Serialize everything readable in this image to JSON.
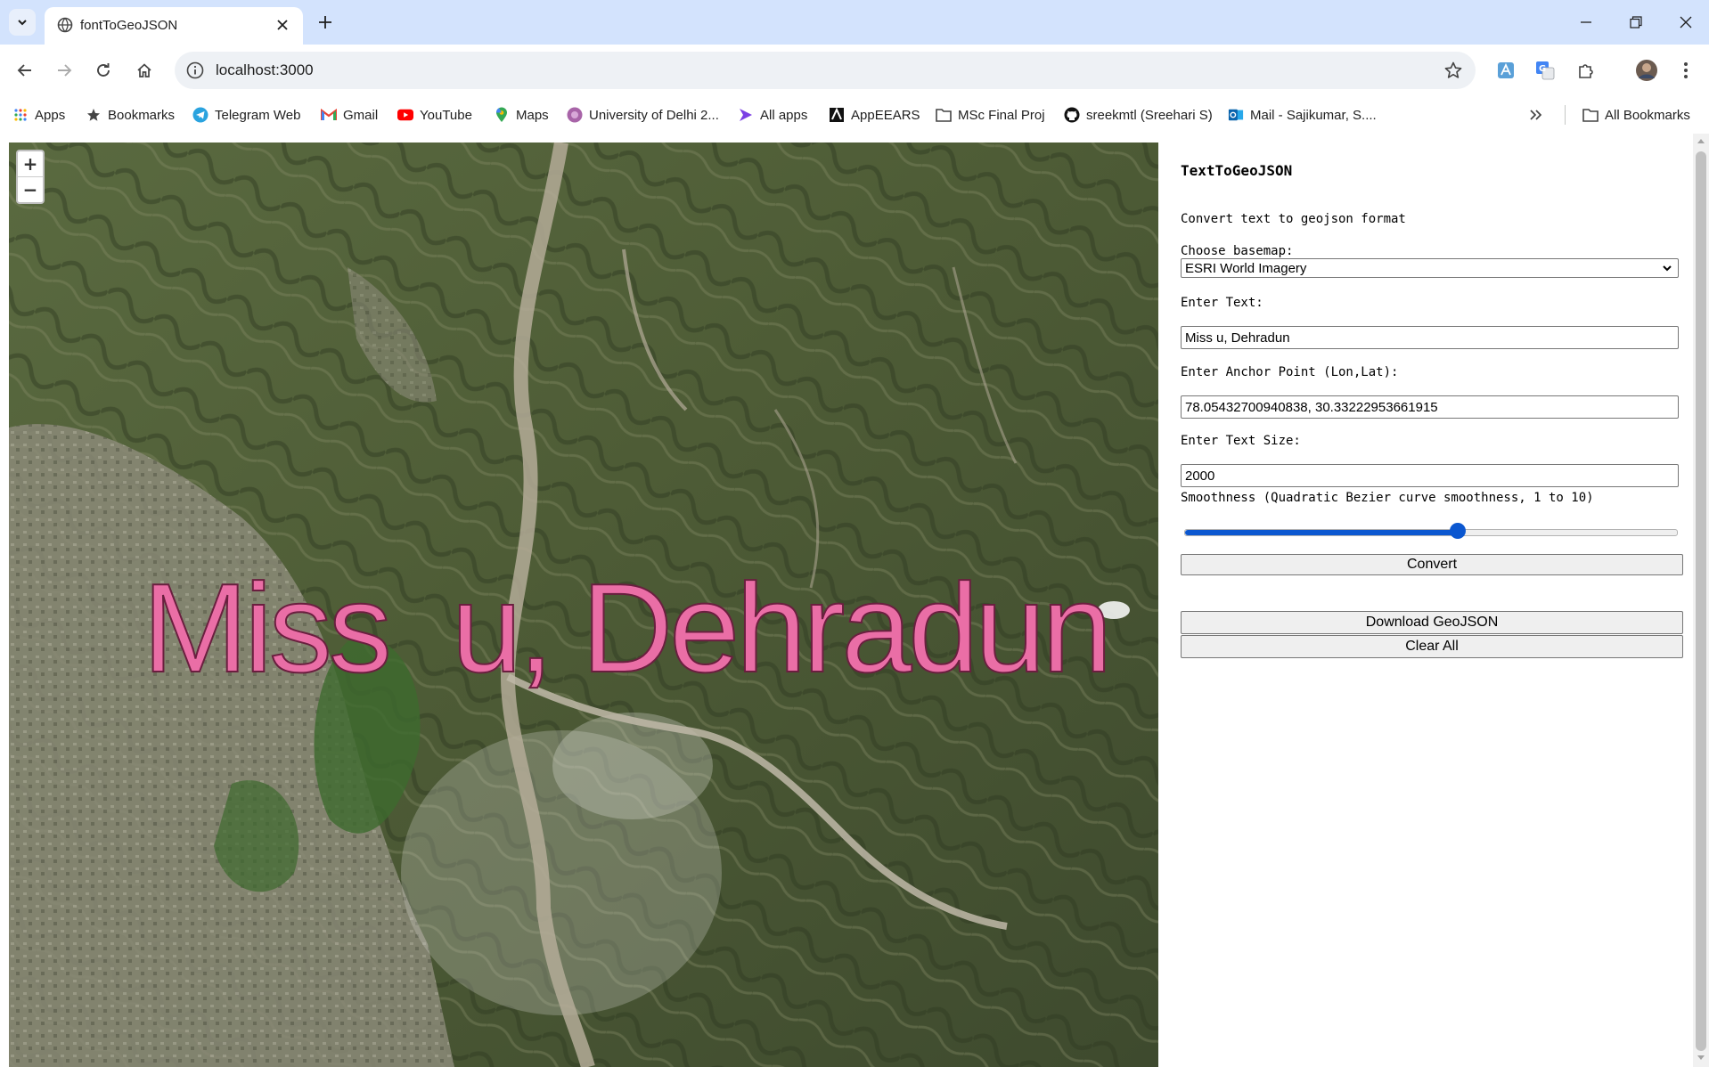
{
  "browser": {
    "tab_title": "fontToGeoJSON",
    "url": "localhost:3000",
    "bookmarks": [
      {
        "label": "Apps",
        "icon": "apps-grid-icon"
      },
      {
        "label": "Bookmarks",
        "icon": "star-icon"
      },
      {
        "label": "Telegram Web",
        "icon": "telegram-icon"
      },
      {
        "label": "Gmail",
        "icon": "gmail-icon"
      },
      {
        "label": "YouTube",
        "icon": "youtube-icon"
      },
      {
        "label": "Maps",
        "icon": "maps-pin-icon"
      },
      {
        "label": "University of Delhi 2...",
        "icon": "university-icon"
      },
      {
        "label": "All apps",
        "icon": "power-apps-icon"
      },
      {
        "label": "AppEEARS",
        "icon": "appeears-icon"
      },
      {
        "label": "MSc Final Proj",
        "icon": "folder-icon"
      },
      {
        "label": "sreekmtl (Sreehari S)",
        "icon": "github-icon"
      },
      {
        "label": "Mail - Sajikumar, S....",
        "icon": "outlook-icon"
      }
    ],
    "all_bookmarks_label": "All Bookmarks",
    "accent": "#d3e3fd"
  },
  "map": {
    "basemap_overlay_text": "Miss  u, Dehradun",
    "zoom_in": "+",
    "zoom_out": "−",
    "text_color": "#ea6ea6"
  },
  "panel": {
    "title": "TextToGeoJSON",
    "subtitle": "Convert text to geojson format",
    "basemap_label": "Choose basemap:",
    "basemap_value": "ESRI World Imagery",
    "text_label": "Enter Text:",
    "text_value": "Miss u, Dehradun",
    "anchor_label": "Enter Anchor Point (Lon,Lat):",
    "anchor_value": "78.05432700940838, 30.33222953661915",
    "size_label": "Enter Text Size:",
    "size_value": "2000",
    "smoothness_label": "Smoothness (Quadratic Bezier curve smoothness, 1 to 10)",
    "smoothness_min": 1,
    "smoothness_max": 10,
    "smoothness_value": 6,
    "convert_label": "Convert",
    "download_label": "Download GeoJSON",
    "clear_label": "Clear All"
  }
}
